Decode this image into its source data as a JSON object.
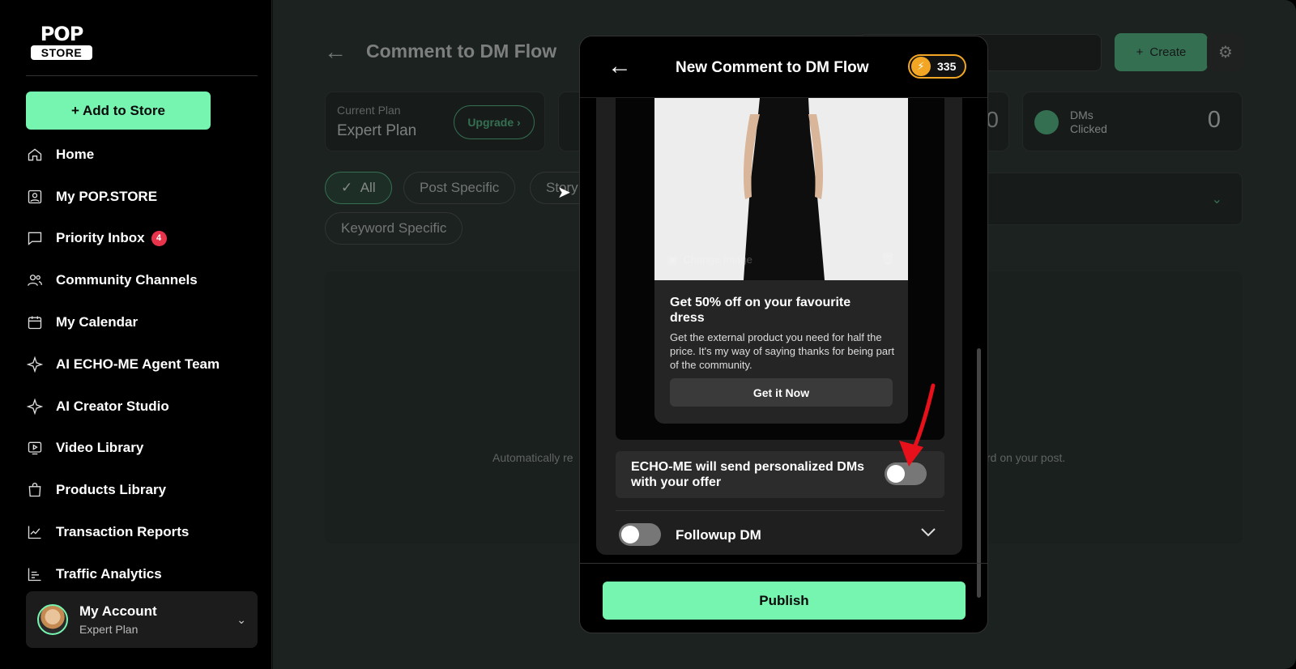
{
  "brand": {
    "logo_top": "POP",
    "logo_bottom": "STORE"
  },
  "sidebar": {
    "add_label": "+ Add to Store",
    "items": [
      {
        "label": "Home",
        "icon": "home-icon"
      },
      {
        "label": "My POP.STORE",
        "icon": "user-square-icon"
      },
      {
        "label": "Priority Inbox",
        "icon": "chat-icon",
        "badge": "4"
      },
      {
        "label": "Community Channels",
        "icon": "users-icon"
      },
      {
        "label": "My Calendar",
        "icon": "calendar-icon"
      },
      {
        "label": "AI ECHO-ME Agent Team",
        "icon": "sparkle-icon"
      },
      {
        "label": "AI Creator Studio",
        "icon": "sparkle-icon"
      },
      {
        "label": "Video Library",
        "icon": "video-icon"
      },
      {
        "label": "Products Library",
        "icon": "bag-icon"
      },
      {
        "label": "Transaction Reports",
        "icon": "chart-line-icon"
      },
      {
        "label": "Traffic Analytics",
        "icon": "bar-chart-icon"
      }
    ],
    "account": {
      "name": "My Account",
      "plan": "Expert Plan"
    }
  },
  "main": {
    "title": "Comment to DM Flow",
    "create_label": "Create",
    "plan_card": {
      "label": "Current Plan",
      "value": "Expert Plan",
      "upgrade": "Upgrade"
    },
    "zero_value": "0",
    "dm_card": {
      "label_line1": "DMs",
      "label_line2": "Clicked",
      "value": "0"
    },
    "filters": [
      "All",
      "Post Specific",
      "Story",
      "Keyword Specific"
    ],
    "empty_left": "Automatically re",
    "empty_right": "rd on your post."
  },
  "modal": {
    "title": "New Comment to DM Flow",
    "credits": "335",
    "product": {
      "change_image": "Change Image",
      "title": "Get 50% off on your favourite dress",
      "description": "Get the external product you need for half the price. It's my way of saying thanks for being part of the community.",
      "cta": "Get it Now"
    },
    "echo_text": "ECHO-ME will send personalized DMs with your offer",
    "echo_enabled": false,
    "followup_label": "Followup DM",
    "followup_enabled": false,
    "publish_label": "Publish"
  },
  "colors": {
    "accent": "#75f5b0",
    "annotation_arrow": "#e8101a",
    "credits": "#f2a623"
  }
}
